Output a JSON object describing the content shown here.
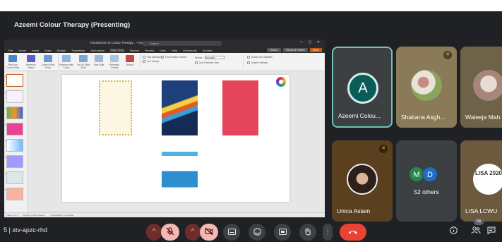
{
  "meeting": {
    "title": "Azeemi Colour Therapy (Presenting)",
    "code": "xtv-apzc-rhd",
    "code_prefix": "5  |"
  },
  "app": {
    "window_title": "Introduction to Colour Therapy... • Saved to this PC",
    "search_placeholder": "Search",
    "tabs": [
      "File",
      "Home",
      "Insert",
      "Draw",
      "Design",
      "Transitions",
      "Animations",
      "Slide Show",
      "Record",
      "Review",
      "View",
      "Help",
      "Grammarly",
      "Acrobat"
    ],
    "record_btn": "Record",
    "present_btn": "Present in Teams",
    "share_btn": "Share",
    "ribbon": {
      "groups": [
        "Play from Current Slide",
        "Present in Teams",
        "Custom Slide Show",
        "Rehearse with Coach",
        "Set Up Slide Show",
        "Hide Slide",
        "Rehearse Timings",
        "Record"
      ],
      "options": [
        "Play Narrations",
        "Use Timings",
        "Show Media Controls",
        "Always Use Subtitles",
        "Subtitle Settings"
      ],
      "monitor_label": "Monitor:",
      "monitor_value": "Automatic",
      "presenter_view": "Use Presenter View"
    },
    "slide_numbers": [
      "1",
      "2",
      "3",
      "4",
      "5",
      "6",
      "7",
      "8"
    ],
    "status": [
      "Slide 1 of 1",
      "English (United States)",
      "Accessibility: Investigate"
    ]
  },
  "participants": [
    {
      "name": "Azeemi Colou...",
      "initial": "A"
    },
    {
      "name": "Shabana Asgh..."
    },
    {
      "name": "Waleeja Mah"
    },
    {
      "name": "Unica Aslam"
    },
    {
      "name": "52 others",
      "avatars": [
        "M",
        "D"
      ]
    },
    {
      "name": "LISA LCWU",
      "logo_text": "LISA 2020"
    }
  ],
  "controls": [
    "chevron-up",
    "mic-off",
    "chevron-up",
    "camera-off",
    "captions",
    "emoji",
    "present",
    "raise-hand",
    "more",
    "leave-call"
  ],
  "participant_count": "58",
  "colors": {
    "bg": "#202124",
    "tile": "#3c4043",
    "active_border": "#6fc3b3",
    "mic_off": "#f2b8b5",
    "leave": "#ea4335"
  }
}
